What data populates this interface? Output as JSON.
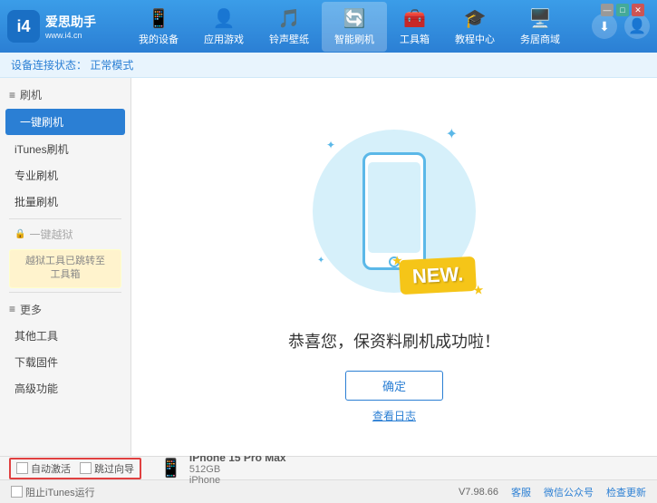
{
  "app": {
    "logo_icon": "i4",
    "logo_title": "爱思助手",
    "logo_subtitle": "www.i4.cn"
  },
  "nav": {
    "items": [
      {
        "id": "my-device",
        "icon": "📱",
        "label": "我的设备"
      },
      {
        "id": "apps-games",
        "icon": "👤",
        "label": "应用游戏"
      },
      {
        "id": "ringtone",
        "icon": "🎵",
        "label": "铃声壁纸"
      },
      {
        "id": "smart-flash",
        "icon": "🔄",
        "label": "智能刷机",
        "active": true
      },
      {
        "id": "toolbox",
        "icon": "🧰",
        "label": "工具箱"
      },
      {
        "id": "tutorial",
        "icon": "🎓",
        "label": "教程中心"
      },
      {
        "id": "service",
        "icon": "🖥️",
        "label": "务居商域"
      }
    ]
  },
  "breadcrumb": {
    "prefix": "设备连接状态：",
    "status": "正常模式"
  },
  "sidebar": {
    "flash_section": "刷机",
    "items": [
      {
        "id": "one-key-flash",
        "label": "一键刷机",
        "active": true
      },
      {
        "id": "itunes-flash",
        "label": "iTunes刷机"
      },
      {
        "id": "pro-flash",
        "label": "专业刷机"
      },
      {
        "id": "batch-flash",
        "label": "批量刷机"
      }
    ],
    "disabled_item": "一键越狱",
    "notice_text": "越狱工具已跳转至\n工具箱",
    "more_section": "更多",
    "more_items": [
      {
        "id": "other-tools",
        "label": "其他工具"
      },
      {
        "id": "download-firmware",
        "label": "下载固件"
      },
      {
        "id": "advanced",
        "label": "高级功能"
      }
    ]
  },
  "content": {
    "success_text": "恭喜您，保资料刷机成功啦！",
    "confirm_btn": "确定",
    "log_link": "查看日志"
  },
  "bottom": {
    "auto_activate": "自动激活",
    "guide_activate": "跳过向导",
    "device_name": "iPhone 15 Pro Max",
    "device_storage": "512GB",
    "device_type": "iPhone"
  },
  "statusbar": {
    "itunes_label": "阻止iTunes运行",
    "version": "V7.98.66",
    "links": [
      "客服",
      "微信公众号",
      "检查更新"
    ]
  },
  "window_controls": {
    "min": "—",
    "max": "□",
    "close": "✕"
  }
}
